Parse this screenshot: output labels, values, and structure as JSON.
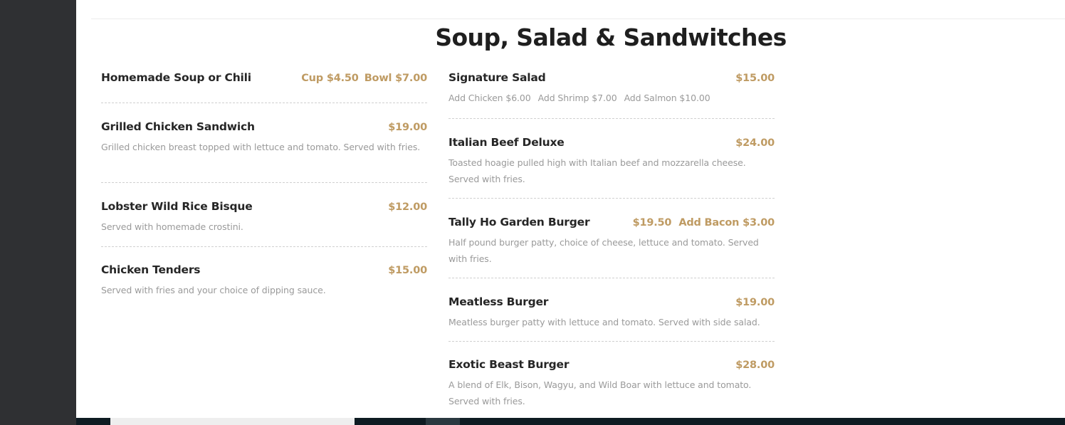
{
  "section": {
    "title": "Soup, Salad & Sandwitches"
  },
  "left_items": [
    {
      "name": "Homemade Soup or Chili",
      "price_1": "Cup $4.50",
      "price_2": "Bowl $7.00",
      "desc": ""
    },
    {
      "name": "Grilled Chicken Sandwich",
      "price_1": "$19.00",
      "price_2": "",
      "desc": "Grilled chicken breast topped with lettuce and tomato. Served with fries."
    },
    {
      "name": "Lobster Wild Rice Bisque",
      "price_1": "$12.00",
      "price_2": "",
      "desc": "Served with homemade crostini."
    },
    {
      "name": "Chicken Tenders",
      "price_1": "$15.00",
      "price_2": "",
      "desc": "Served with fries and your choice of dipping sauce."
    }
  ],
  "right_items": [
    {
      "name": "Signature Salad",
      "price_1": "$15.00",
      "price_2": "",
      "addons": [
        "Add Chicken $6.00",
        "Add Shrimp $7.00",
        "Add Salmon $10.00"
      ]
    },
    {
      "name": "Italian Beef Deluxe",
      "price_1": "$24.00",
      "price_2": "",
      "desc": "Toasted hoagie pulled high with Italian beef and mozzarella cheese. Served with fries."
    },
    {
      "name": "Tally Ho Garden Burger",
      "price_1": "$19.50",
      "price_2": "Add Bacon $3.00",
      "desc": "Half pound burger patty, choice of cheese, lettuce and tomato. Served with fries."
    },
    {
      "name": "Meatless Burger",
      "price_1": "$19.00",
      "price_2": "",
      "desc": "Meatless burger patty with lettuce and tomato. Served with side salad."
    },
    {
      "name": "Exotic Beast Burger",
      "price_1": "$28.00",
      "price_2": "",
      "desc": "A blend of Elk, Bison, Wagyu, and Wild Boar with lettuce and tomato. Served with fries."
    }
  ],
  "colors": {
    "accent_price": "#bf9b63",
    "title": "#1f1f1f",
    "desc": "#9a9a9a",
    "background_dark": "#2f3033"
  }
}
